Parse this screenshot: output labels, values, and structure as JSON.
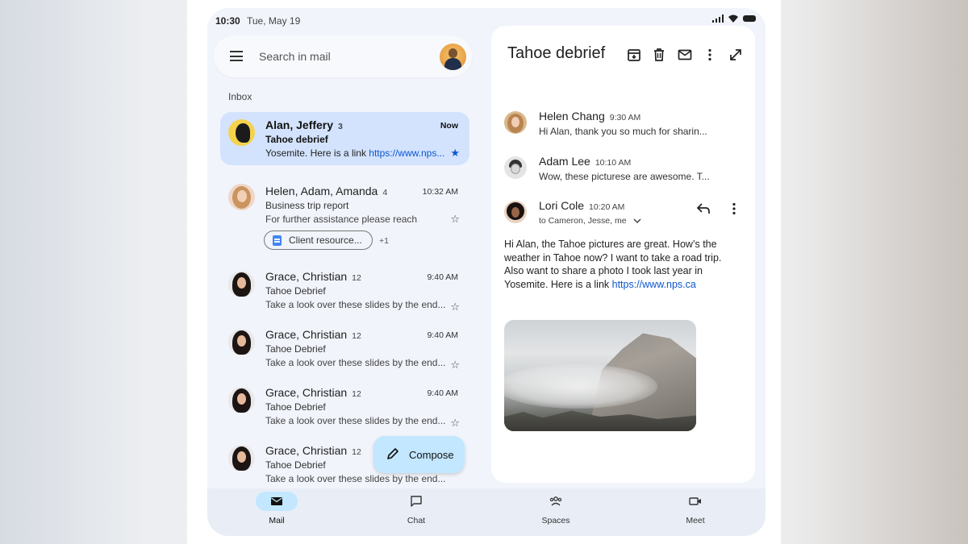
{
  "status": {
    "time": "10:30",
    "date": "Tue, May 19"
  },
  "search": {
    "placeholder": "Search in mail"
  },
  "inbox_label": "Inbox",
  "emails": [
    {
      "from": "Alan, Jeffery",
      "count": "3",
      "time": "Now",
      "subject": "Tahoe debrief",
      "snippet": "Yosemite. Here is a link ",
      "link": "https://www.nps...",
      "starred": true,
      "selected": true
    },
    {
      "from": "Helen, Adam, Amanda",
      "count": "4",
      "time": "10:32 AM",
      "subject": "Business trip report",
      "snippet": "For further assistance please reach",
      "attachment": "Client resource...",
      "attachment_more": "+1",
      "starred": false
    },
    {
      "from": "Grace, Christian",
      "count": "12",
      "time": "9:40 AM",
      "subject": "Tahoe Debrief",
      "snippet": "Take a look over these slides by the end...",
      "starred": false
    },
    {
      "from": "Grace, Christian",
      "count": "12",
      "time": "9:40 AM",
      "subject": "Tahoe Debrief",
      "snippet": "Take a look over these slides by the end...",
      "starred": false
    },
    {
      "from": "Grace, Christian",
      "count": "12",
      "time": "9:40 AM",
      "subject": "Tahoe Debrief",
      "snippet": "Take a look over these slides by the end...",
      "starred": false
    },
    {
      "from": "Grace, Christian",
      "count": "12",
      "time": "",
      "subject": "Tahoe Debrief",
      "snippet": "Take a look over these slides by the end...",
      "starred": false
    }
  ],
  "compose_label": "Compose",
  "nav": [
    {
      "label": "Mail",
      "icon": "mail-icon",
      "active": true
    },
    {
      "label": "Chat",
      "icon": "chat-icon"
    },
    {
      "label": "Spaces",
      "icon": "spaces-icon"
    },
    {
      "label": "Meet",
      "icon": "meet-icon"
    }
  ],
  "detail": {
    "title": "Tahoe debrief",
    "toolbar_icons": [
      "archive-icon",
      "delete-icon",
      "mark-unread-icon",
      "more-vert-icon",
      "expand-icon"
    ],
    "messages": [
      {
        "from": "Helen Chang",
        "time": "9:30 AM",
        "snippet": "Hi Alan, thank you so much for sharin..."
      },
      {
        "from": "Adam Lee",
        "time": "10:10 AM",
        "snippet": "Wow, these picturese are awesome. T..."
      },
      {
        "from": "Lori Cole",
        "time": "10:20 AM",
        "to": "to Cameron, Jesse, me"
      }
    ],
    "body_text": "Hi Alan, the Tahoe pictures are great. How’s the weather in Tahoe now? I want to take a road trip. Also want to share a photo I took last year in Yosemite. Here is a link ",
    "body_link": "https://www.nps.ca"
  },
  "colors": {
    "accent": "#0b57d0",
    "selected_bg": "#d3e3fd",
    "compose_bg": "#c2e7ff",
    "surface": "#f1f4fb"
  }
}
